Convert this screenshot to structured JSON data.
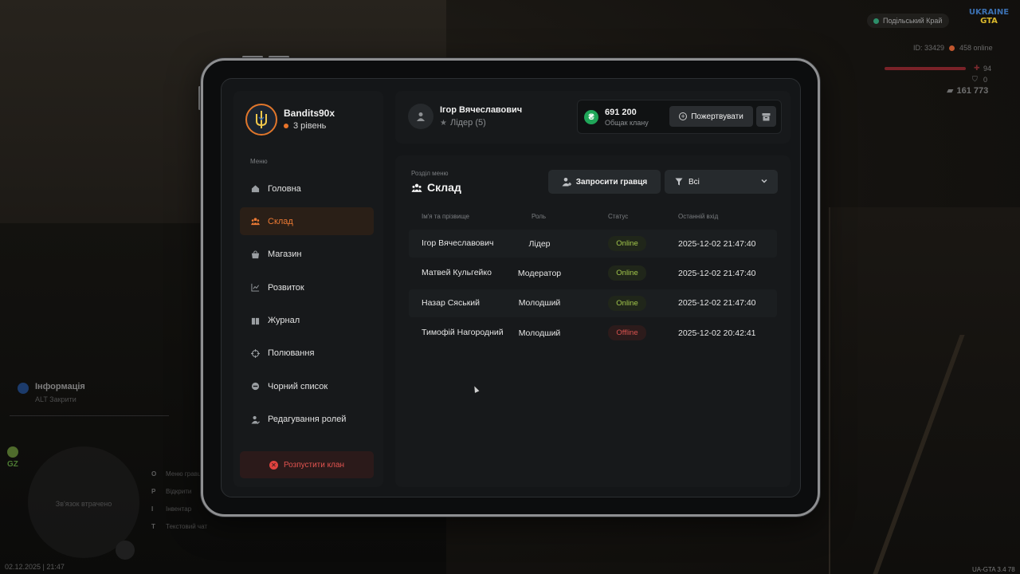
{
  "hud": {
    "server_name": "Подільський Край",
    "logo_line1": "UKRAINE",
    "logo_line2": "GTA",
    "player_id": "ID: 33429",
    "online": "458 online",
    "health": "94",
    "armor": "0",
    "money": "161 773",
    "info_title": "Інформація",
    "info_hint": "ALT Закрити",
    "zone": "GZ",
    "minimap_text": "Зв'язок втрачено",
    "keys": [
      {
        "key": "O",
        "label": "Меню гравця"
      },
      {
        "key": "P",
        "label": "Відкрити"
      },
      {
        "key": "I",
        "label": "Інвентар"
      },
      {
        "key": "T",
        "label": "Текстовий чат"
      }
    ],
    "datetime": "02.12.2025 | 21:47",
    "version": "UA-GTA 3.4",
    "version_num": "78"
  },
  "sidebar": {
    "clan_name": "Bandits90x",
    "clan_level": "3 рівень",
    "menu_caption": "Меню",
    "items": [
      {
        "label": "Головна",
        "icon": "home-icon",
        "active": false
      },
      {
        "label": "Склад",
        "icon": "users-icon",
        "active": true
      },
      {
        "label": "Магазин",
        "icon": "shop-icon",
        "active": false
      },
      {
        "label": "Розвиток",
        "icon": "chart-icon",
        "active": false
      },
      {
        "label": "Журнал",
        "icon": "book-icon",
        "active": false
      },
      {
        "label": "Полювання",
        "icon": "crosshair-icon",
        "active": false
      },
      {
        "label": "Чорний список",
        "icon": "block-icon",
        "active": false
      },
      {
        "label": "Редагування ролей",
        "icon": "user-edit-icon",
        "active": false
      }
    ],
    "disband_label": "Розпустити клан"
  },
  "userbar": {
    "name": "Ігор Вячеславович",
    "role": "Лідер (5)",
    "bank_amount": "691 200",
    "bank_label": "Общак клану",
    "donate_label": "Пожертвувати"
  },
  "panel": {
    "caption": "Розділ меню",
    "title": "Склад",
    "invite_label": "Запросити гравця",
    "filter_value": "Всі",
    "columns": [
      "Ім'я та прізвище",
      "Роль",
      "Статус",
      "Останній вхід"
    ],
    "rows": [
      {
        "name": "Ігор Вячеславович",
        "role": "Лідер",
        "status": "Online",
        "last": "2025-12-02 21:47:40"
      },
      {
        "name": "Матвей Кульгейко",
        "role": "Модератор",
        "status": "Online",
        "last": "2025-12-02 21:47:40"
      },
      {
        "name": "Назар Сяський",
        "role": "Молодший",
        "status": "Online",
        "last": "2025-12-02 21:47:40"
      },
      {
        "name": "Тимофій Нагородний",
        "role": "Молодший",
        "status": "Offline",
        "last": "2025-12-02 20:42:41"
      }
    ]
  },
  "colors": {
    "accent": "#e8742a",
    "online": "#a3c84b",
    "offline": "#d9534f",
    "bank": "#20a659"
  }
}
